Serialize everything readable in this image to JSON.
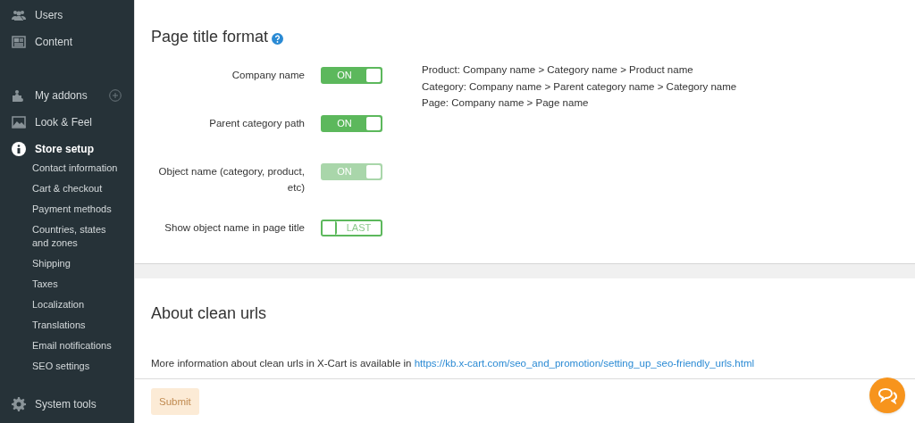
{
  "sidebar": {
    "items": [
      {
        "label": "Users",
        "selected": false
      },
      {
        "label": "Content",
        "selected": false
      },
      {
        "label": "My addons",
        "selected": false
      },
      {
        "label": "Look & Feel",
        "selected": false
      },
      {
        "label": "Store setup",
        "selected": true,
        "children": [
          {
            "label": "Contact information"
          },
          {
            "label": "Cart & checkout"
          },
          {
            "label": "Payment methods"
          },
          {
            "label": "Countries, states and zones"
          },
          {
            "label": "Shipping"
          },
          {
            "label": "Taxes"
          },
          {
            "label": "Localization"
          },
          {
            "label": "Translations"
          },
          {
            "label": "Email notifications"
          },
          {
            "label": "SEO settings"
          }
        ]
      },
      {
        "label": "System tools",
        "selected": false
      }
    ]
  },
  "page_title_section": {
    "title": "Page title format",
    "settings": [
      {
        "label": "Company name",
        "toggle_text": "ON",
        "on": true,
        "disabled": false
      },
      {
        "label": "Parent category path",
        "toggle_text": "ON",
        "on": true,
        "disabled": false
      },
      {
        "label": "Object name (category, product, etc)",
        "toggle_text": "ON",
        "on": true,
        "disabled": true
      },
      {
        "label": "Show object name in page title",
        "toggle_text": "LAST",
        "on": false,
        "disabled": false
      }
    ],
    "examples": [
      "Product: Company name > Category name > Product name",
      "Category: Company name > Parent category name > Category name",
      "Page: Company name > Page name"
    ]
  },
  "clean_urls_section": {
    "title": "About clean urls",
    "text": "More information about clean urls in X-Cart is available in",
    "link": "https://kb.x-cart.com/seo_and_promotion/setting_up_seo-friendly_urls.html"
  },
  "submit": {
    "label": "Submit",
    "disabled": true
  }
}
